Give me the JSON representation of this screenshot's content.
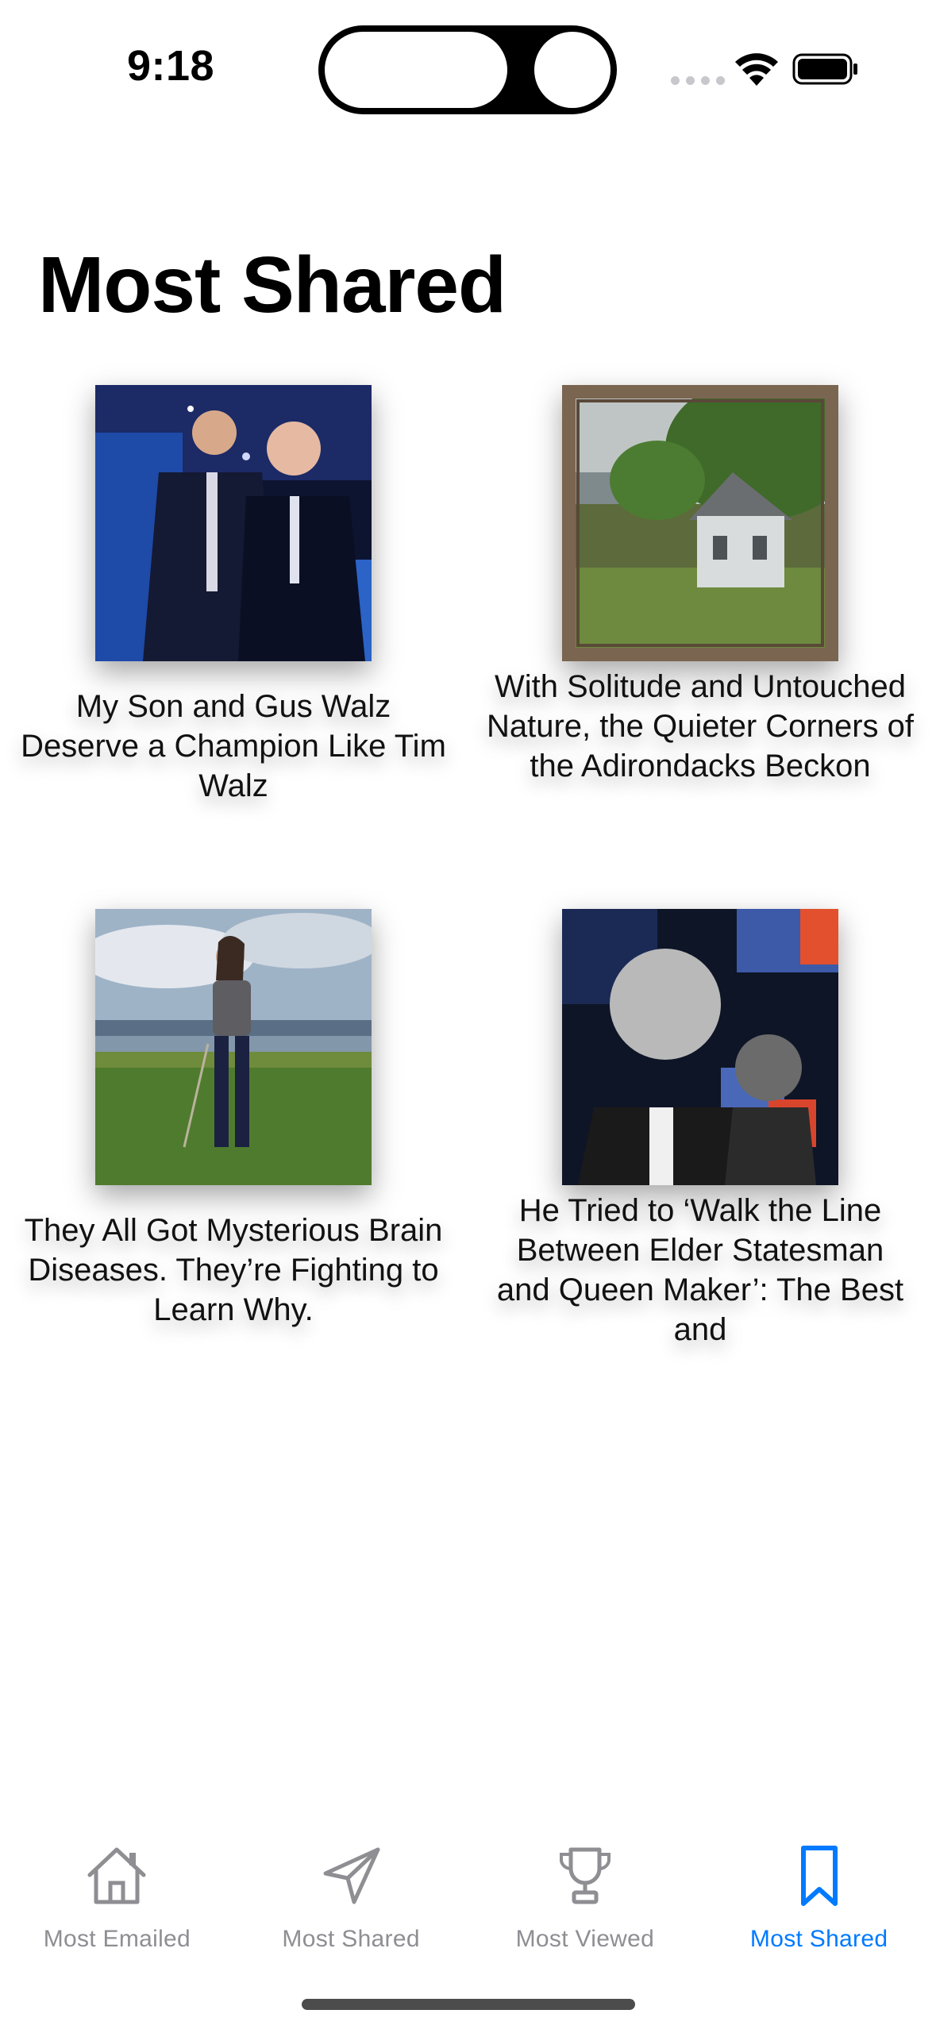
{
  "status_bar": {
    "time": "9:18"
  },
  "page": {
    "title": "Most Shared"
  },
  "articles": [
    {
      "title": "My Son and Gus Walz Deserve a Champion Like Tim Walz",
      "image": "photo-two-men-on-stage"
    },
    {
      "title": "With Solitude and Untouched Nature, the Quieter Corners of the Adirondacks Beckon",
      "image": "photo-cabin-through-frame"
    },
    {
      "title": "They All Got Mysterious Brain Diseases. They’re Fighting to Learn Why.",
      "image": "photo-woman-in-field"
    },
    {
      "title": "He Tried to ‘Walk the Line Between Elder Statesman and Queen Maker’: The Best and",
      "image": "photo-collage-man-and-woman"
    }
  ],
  "tab_bar": {
    "active_index": 3,
    "active_color": "#007aff",
    "inactive_color": "#8e8e93",
    "tabs": [
      {
        "label": "Most Emailed",
        "icon": "house-icon"
      },
      {
        "label": "Most Shared",
        "icon": "paper-plane-icon"
      },
      {
        "label": "Most Viewed",
        "icon": "trophy-icon"
      },
      {
        "label": "Most Shared",
        "icon": "bookmark-icon"
      }
    ]
  }
}
